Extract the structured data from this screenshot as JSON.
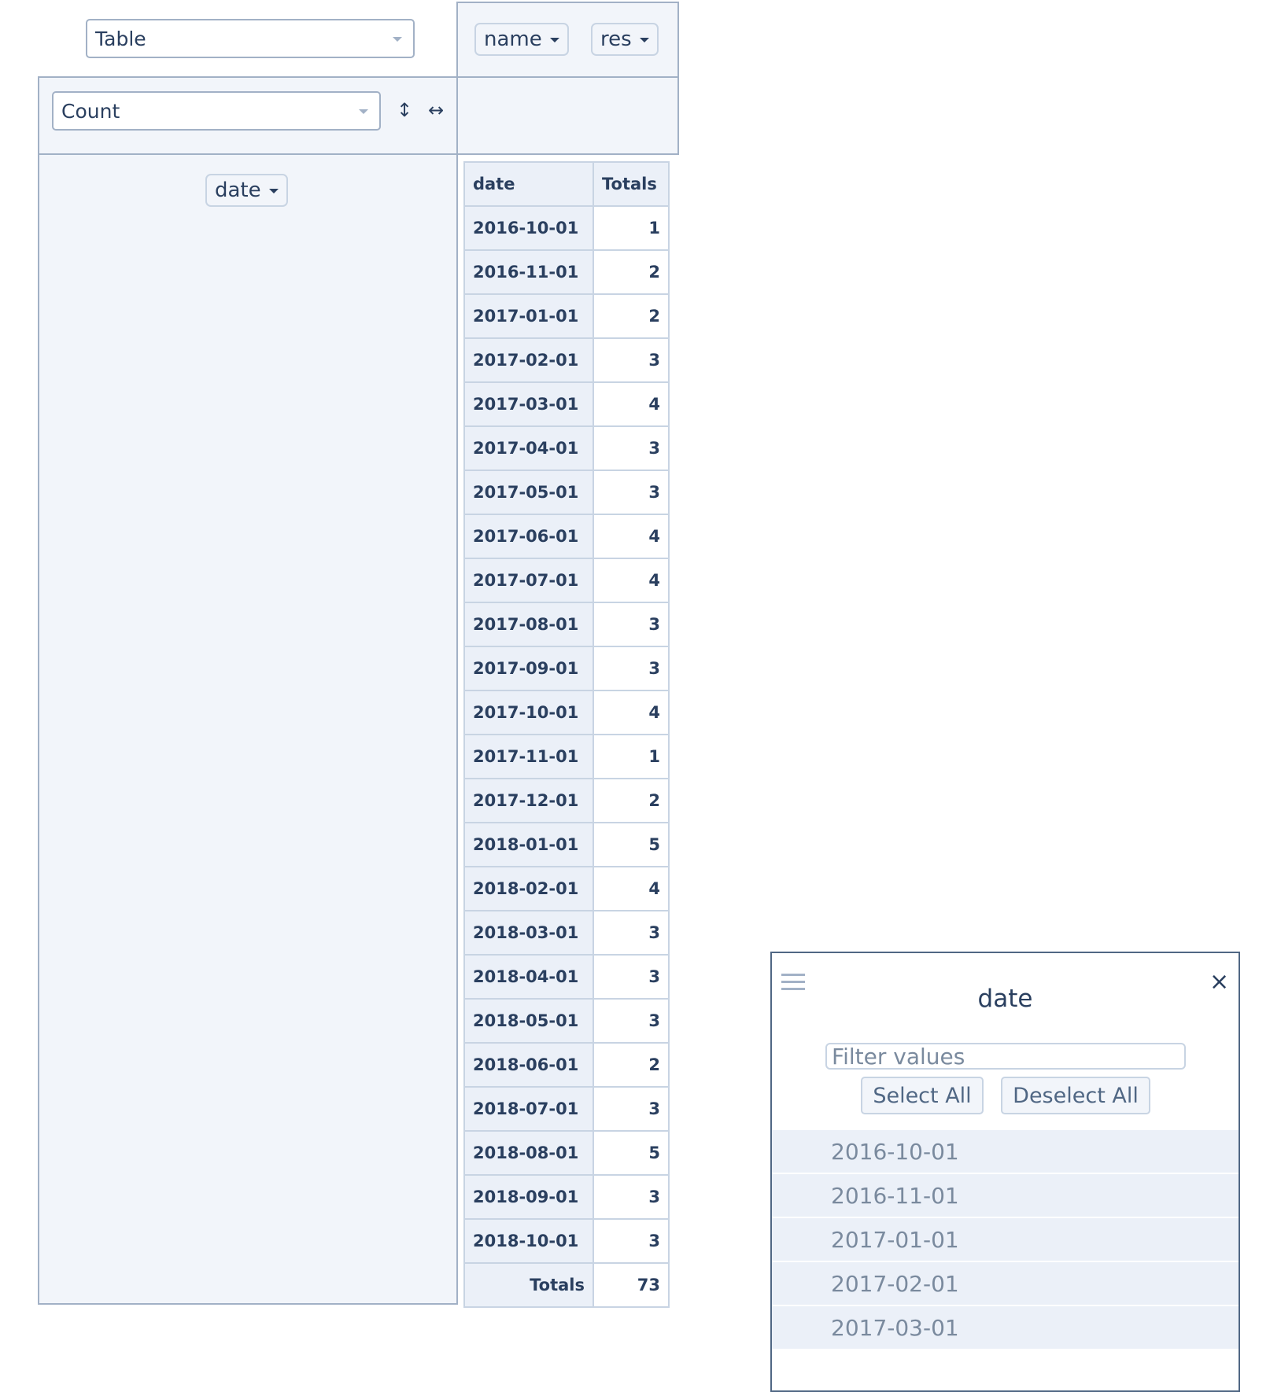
{
  "renderer": {
    "selected": "Table"
  },
  "aggregator": {
    "selected": "Count"
  },
  "controls": {
    "row_order_icon": "↕",
    "col_order_icon": "↔"
  },
  "col_attributes": [
    {
      "label": "name"
    },
    {
      "label": "res"
    }
  ],
  "row_attributes": [
    {
      "label": "date"
    }
  ],
  "table": {
    "row_header": "date",
    "totals_header": "Totals",
    "rows": [
      {
        "date": "2016-10-01",
        "total": "1"
      },
      {
        "date": "2016-11-01",
        "total": "2"
      },
      {
        "date": "2017-01-01",
        "total": "2"
      },
      {
        "date": "2017-02-01",
        "total": "3"
      },
      {
        "date": "2017-03-01",
        "total": "4"
      },
      {
        "date": "2017-04-01",
        "total": "3"
      },
      {
        "date": "2017-05-01",
        "total": "3"
      },
      {
        "date": "2017-06-01",
        "total": "4"
      },
      {
        "date": "2017-07-01",
        "total": "4"
      },
      {
        "date": "2017-08-01",
        "total": "3"
      },
      {
        "date": "2017-09-01",
        "total": "3"
      },
      {
        "date": "2017-10-01",
        "total": "4"
      },
      {
        "date": "2017-11-01",
        "total": "1"
      },
      {
        "date": "2017-12-01",
        "total": "2"
      },
      {
        "date": "2018-01-01",
        "total": "5"
      },
      {
        "date": "2018-02-01",
        "total": "4"
      },
      {
        "date": "2018-03-01",
        "total": "3"
      },
      {
        "date": "2018-04-01",
        "total": "3"
      },
      {
        "date": "2018-05-01",
        "total": "3"
      },
      {
        "date": "2018-06-01",
        "total": "2"
      },
      {
        "date": "2018-07-01",
        "total": "3"
      },
      {
        "date": "2018-08-01",
        "total": "5"
      },
      {
        "date": "2018-09-01",
        "total": "3"
      },
      {
        "date": "2018-10-01",
        "total": "3"
      }
    ],
    "grand_total_label": "Totals",
    "grand_total": "73"
  },
  "filter": {
    "title": "date",
    "close_icon": "×",
    "placeholder": "Filter values",
    "select_all": "Select All",
    "deselect_all": "Deselect All",
    "values": [
      "2016-10-01",
      "2016-11-01",
      "2017-01-01",
      "2017-02-01",
      "2017-03-01"
    ]
  },
  "colors": {
    "panel_bg": "#f2f5fa",
    "panel_border": "#a2b1c6",
    "text": "#2a3f5f",
    "header_bg": "#ebf0f8"
  }
}
